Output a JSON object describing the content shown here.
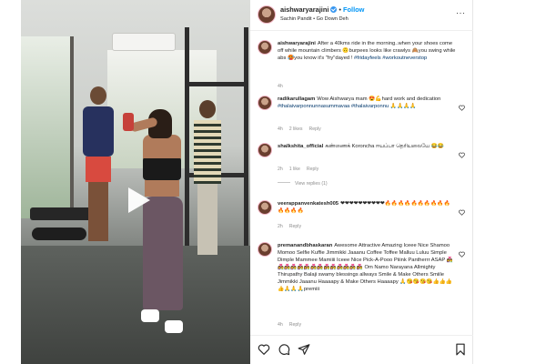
{
  "header": {
    "username": "aishwaryarajini",
    "follow_label": "Follow",
    "separator": "•",
    "song": "Sachin Pandit • Go Down Deh",
    "more": "···"
  },
  "caption": {
    "username": "aishwaryarajini",
    "text": "After a 40kms ride in the morning..when your shoes come off while mountain climbers 🙃burpees looks like crawlys 🙈you swing while abs 🥵you know it's \"fry\"dayed !",
    "hashtags": "#fridayfeels #workoutneverstop",
    "time": "4h"
  },
  "comments": [
    {
      "username": "radikarullagam",
      "text": "Wow Aishwarya mam 😍💪hard work and dedication ",
      "tags": "#thalaivarponnunnasummavaa #thalaivarponnu",
      "trail": "🙏🙏🙏🙏",
      "time": "4h",
      "likes": "2 likes",
      "reply": "Reply"
    },
    {
      "username": "shalkshita_official",
      "text": "கண்ணைக் Koroncha ஈயப்பா தெரியலையே 😂😂",
      "tags": "",
      "trail": "",
      "time": "2h",
      "likes": "1 like",
      "reply": "Reply",
      "view_replies": "View replies (1)"
    },
    {
      "username": "veerappanvenkatesh005",
      "text": "❤❤❤❤❤❤❤❤❤❤🔥🔥🔥🔥🔥🔥🔥🔥🔥🔥🔥🔥🔥🔥",
      "tags": "",
      "trail": "",
      "time": "2h",
      "likes": "",
      "reply": "Reply"
    },
    {
      "username": "premanandbhaskaran",
      "text": "Awesome Attractive Amazing Iceee Nice Shamoo Momoo Selfie Kuffie Jimmikki Jaaanu Coffee Toffee Malluu Luluu Simple Dimple Mammee Mamiiii Iceee Nice Pick-A-Pooo Piiink Pantherrr ASAP 👩‍❤️‍👨👩‍❤️‍👨👩‍❤️‍👨👩‍❤️‍👨👩‍❤️‍👨👩‍❤️‍👨👩‍❤️‍👨👩‍❤️‍👨👩‍❤️‍👨👩‍❤️‍👨👩‍❤️‍👨👩‍❤️‍👨👩‍❤️‍👨👩‍❤️‍👨 Om Namo Narayana Allmighty Thirupathy Balaji swamy blessings allways Smile & Make Others Smiile Jimmikki Jaaanu Haaaapy & Make Others Haaaapy 🙏😘😘😘😘👍👍👍👍🙏🙏🙏premiii",
      "tags": "",
      "trail": "",
      "time": "4h",
      "likes": "",
      "reply": "Reply"
    }
  ],
  "colors": {
    "accent": "#0095f6",
    "tag": "#00376b",
    "muted": "#8e8e8e",
    "text": "#262626"
  },
  "icons": [
    "play-icon",
    "heart-icon",
    "comment-icon",
    "share-icon",
    "bookmark-icon",
    "verified-icon",
    "more-icon"
  ]
}
